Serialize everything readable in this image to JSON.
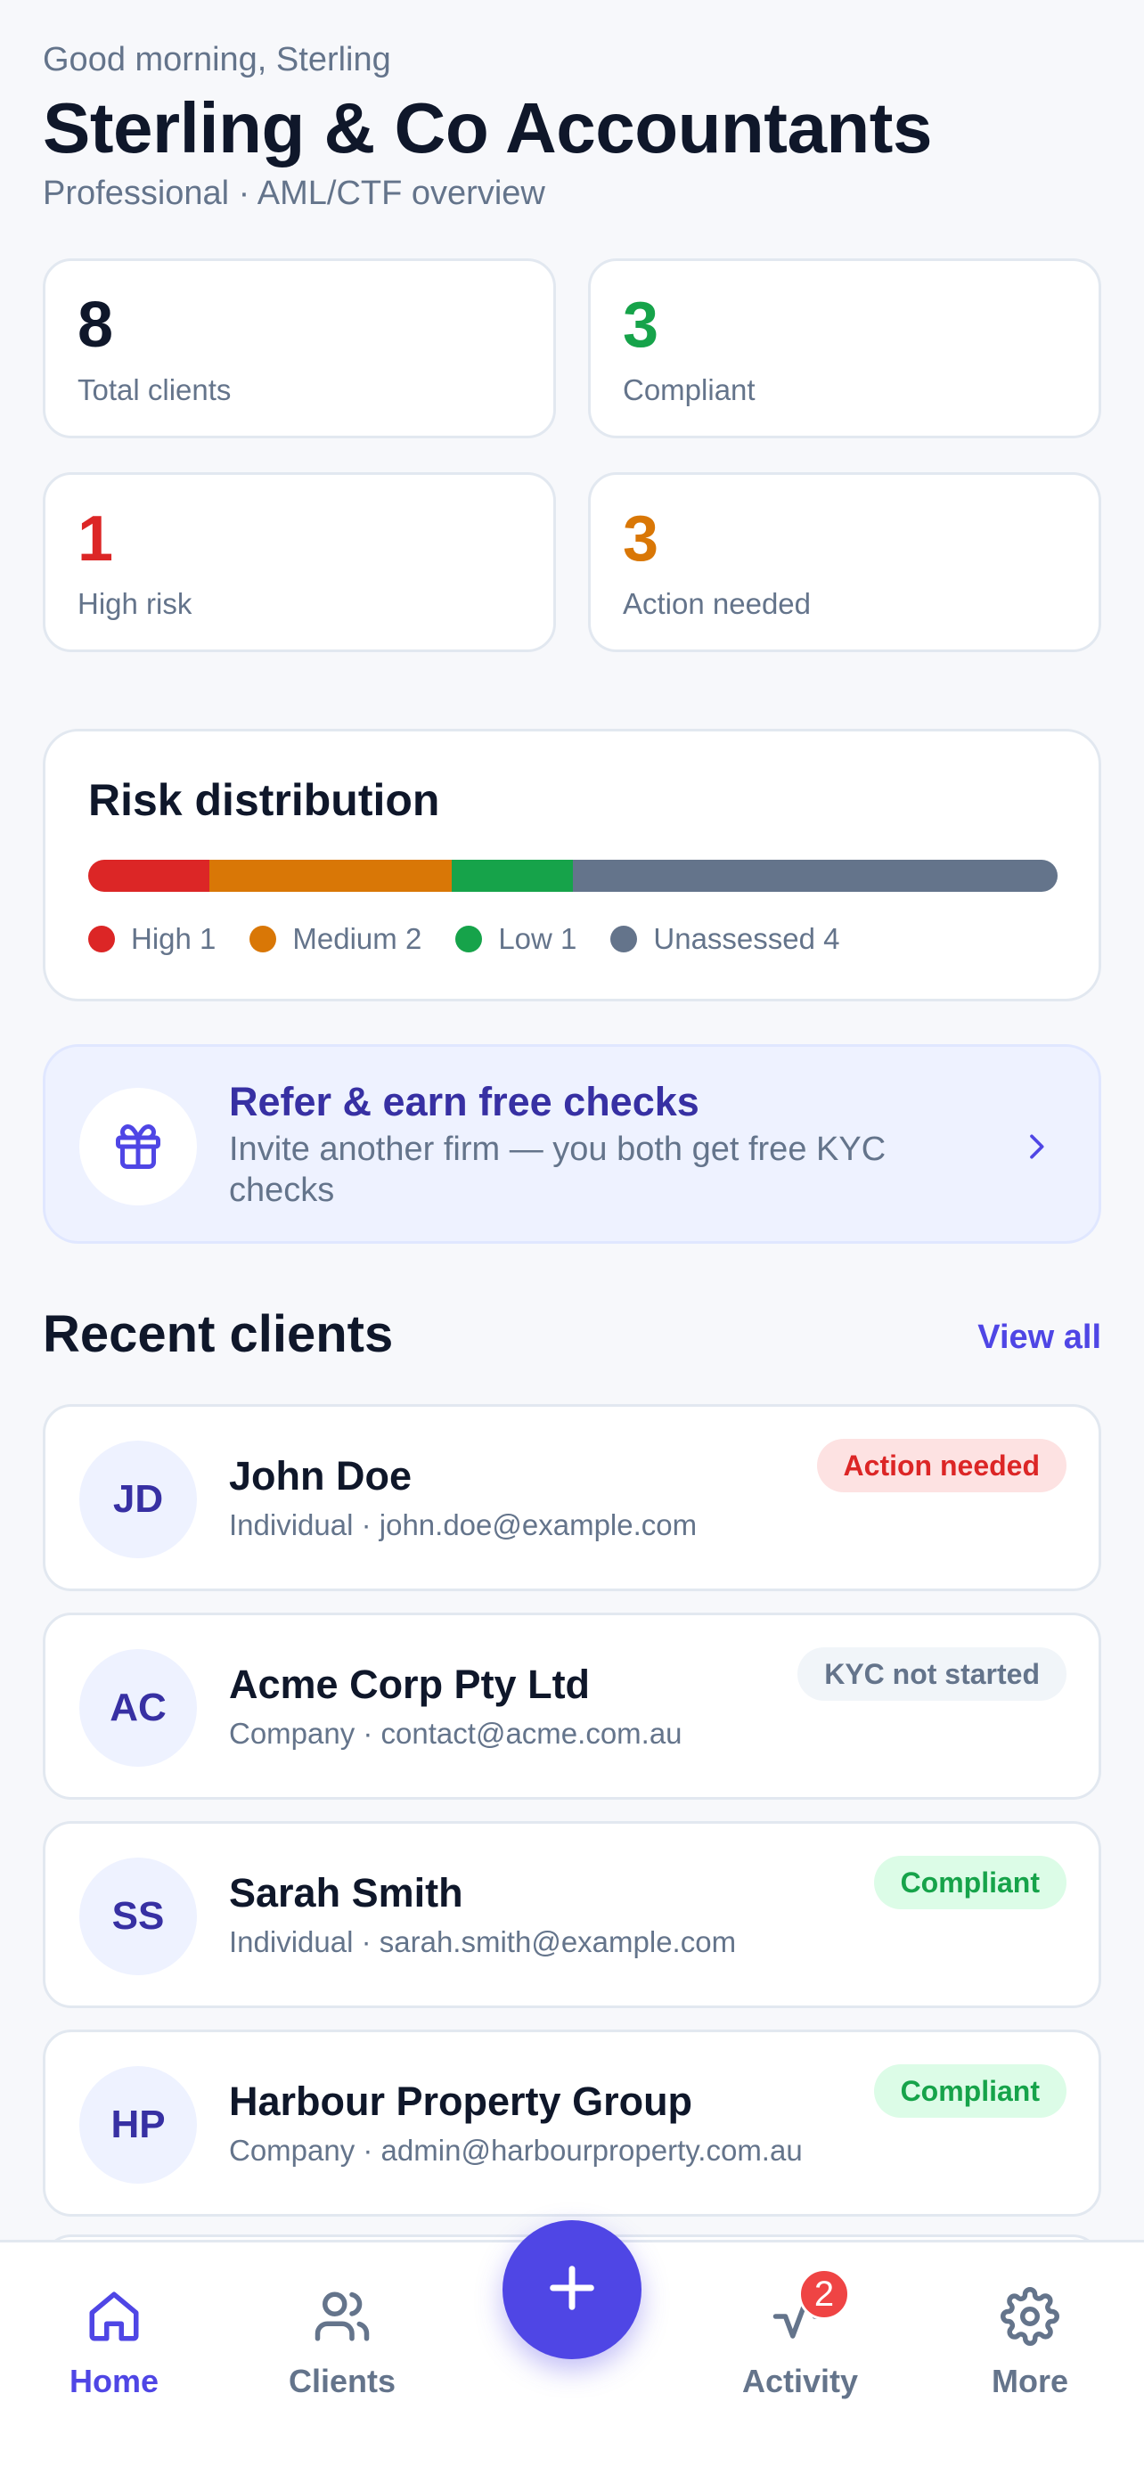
{
  "header": {
    "greeting": "Good morning, Sterling",
    "firm_name": "Sterling & Co Accountants",
    "subtitle": "Professional · AML/CTF overview"
  },
  "stats": [
    {
      "value": "8",
      "label": "Total clients",
      "color": "#0f172a"
    },
    {
      "value": "3",
      "label": "Compliant",
      "color": "#16a34a"
    },
    {
      "value": "1",
      "label": "High risk",
      "color": "#dc2626"
    },
    {
      "value": "3",
      "label": "Action needed",
      "color": "#d97706"
    }
  ],
  "risk": {
    "title": "Risk distribution",
    "segments": [
      {
        "label": "High",
        "count": "1",
        "color": "#dc2626"
      },
      {
        "label": "Medium",
        "count": "2",
        "color": "#d97706"
      },
      {
        "label": "Low",
        "count": "1",
        "color": "#16a34a"
      },
      {
        "label": "Unassessed",
        "count": "4",
        "color": "#64748b"
      }
    ]
  },
  "referral": {
    "title": "Refer & earn free checks",
    "text": "Invite another firm — you both get free KYC checks",
    "icon": "gift-icon"
  },
  "recent": {
    "title": "Recent clients",
    "view_all": "View all",
    "clients": [
      {
        "initials": "JD",
        "name": "John Doe",
        "meta": "Individual · john.doe@example.com",
        "status": "Action needed",
        "status_type": "red"
      },
      {
        "initials": "AC",
        "name": "Acme Corp Pty Ltd",
        "meta": "Company · contact@acme.com.au",
        "status": "KYC not started",
        "status_type": "gray"
      },
      {
        "initials": "SS",
        "name": "Sarah Smith",
        "meta": "Individual · sarah.smith@example.com",
        "status": "Compliant",
        "status_type": "green"
      },
      {
        "initials": "HP",
        "name": "Harbour Property Group",
        "meta": "Company · admin@harbourproperty.com.au",
        "status": "Compliant",
        "status_type": "green"
      }
    ]
  },
  "tabs": {
    "home": "Home",
    "clients": "Clients",
    "activity": "Activity",
    "more": "More",
    "activity_badge": "2"
  },
  "colors": {
    "accent": "#4f46e5"
  }
}
